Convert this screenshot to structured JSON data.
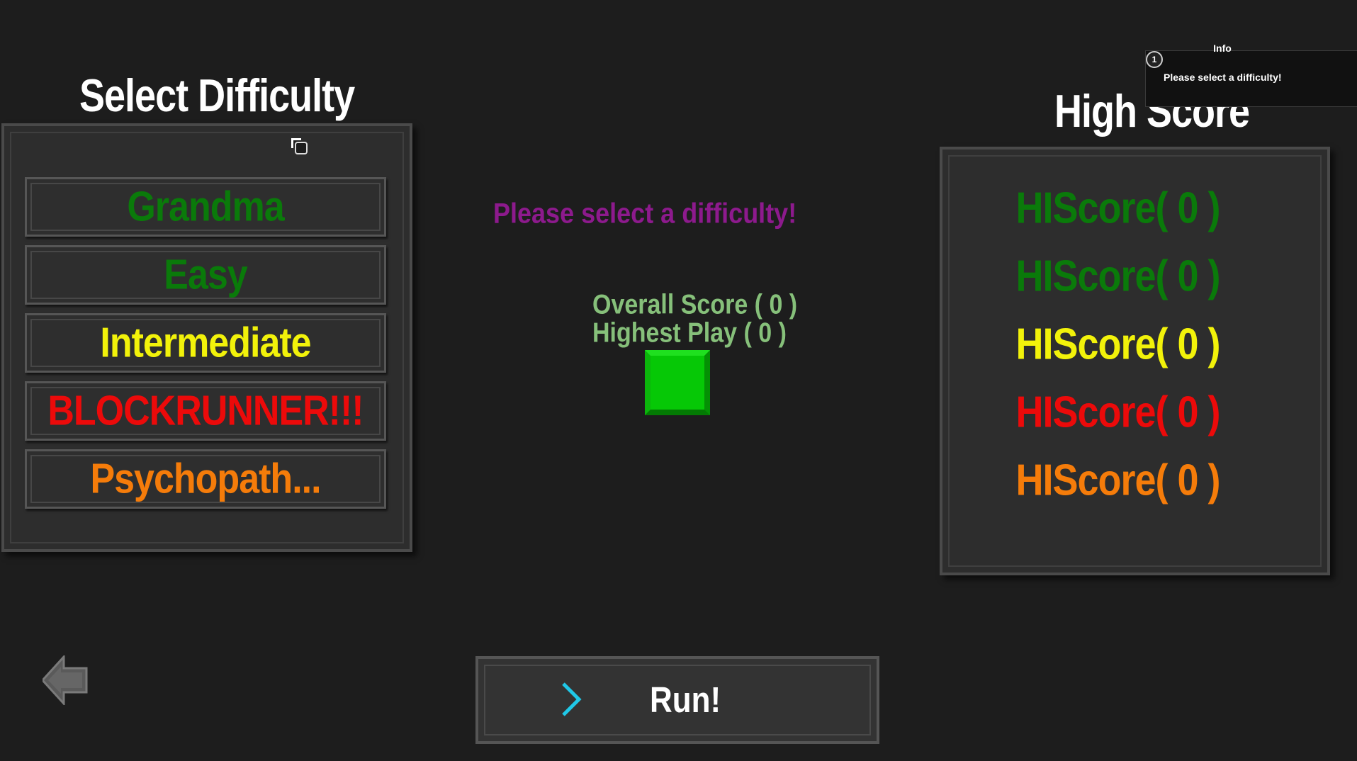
{
  "left_section": {
    "title": "Select Difficulty",
    "difficulties": [
      {
        "label": "Grandma",
        "color": "#0a7a0a"
      },
      {
        "label": "Easy",
        "color": "#0a7a0a"
      },
      {
        "label": "Intermediate",
        "color": "#f2f20a"
      },
      {
        "label": "BLOCKRUNNER!!!",
        "color": "#ec0a0a"
      },
      {
        "label": "Psychopath...",
        "color": "#f57c0a"
      }
    ]
  },
  "center": {
    "prompt": "Please select a difficulty!",
    "overall_score": "Overall Score ( 0 )",
    "highest_play": "Highest Play ( 0 )",
    "player_block_color": "#06c806",
    "run_button_label": "Run!"
  },
  "right_section": {
    "title": "High Score",
    "scores": [
      {
        "label": "HIScore( 0 )",
        "color": "#0a7a0a"
      },
      {
        "label": "HIScore( 0 )",
        "color": "#0a7a0a"
      },
      {
        "label": "HIScore( 0 )",
        "color": "#f2f20a"
      },
      {
        "label": "HIScore( 0 )",
        "color": "#ec0a0a"
      },
      {
        "label": "HIScore( 0 )",
        "color": "#f57c0a"
      }
    ]
  },
  "info_popup": {
    "title": "Info",
    "badge": "1",
    "message": "Please select a difficulty!"
  },
  "icons": {
    "back": "arrow-left-icon",
    "run": "chevron-right-icon",
    "cursor": "window-cursor-icon"
  },
  "colors": {
    "background": "#1d1d1d",
    "panel": "#2d2d2d",
    "prompt": "#8d1a8d",
    "score_text": "#86c07a",
    "chevron": "#20c8e8"
  }
}
